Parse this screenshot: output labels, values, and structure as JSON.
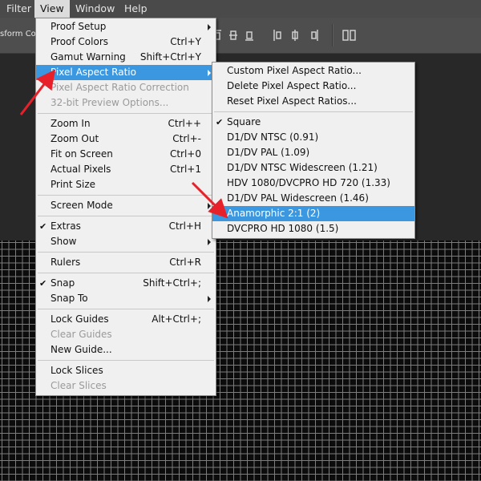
{
  "menubar": {
    "items": [
      {
        "label": "Filter"
      },
      {
        "label": "View"
      },
      {
        "label": "Window"
      },
      {
        "label": "Help"
      }
    ]
  },
  "optionsbar": {
    "transform_label": "sform Con"
  },
  "view_menu": {
    "items": [
      {
        "label": "Proof Setup",
        "shortcut": "",
        "submenu": true
      },
      {
        "label": "Proof Colors",
        "shortcut": "Ctrl+Y"
      },
      {
        "label": "Gamut Warning",
        "shortcut": "Shift+Ctrl+Y"
      },
      {
        "label": "Pixel Aspect Ratio",
        "shortcut": "",
        "submenu": true,
        "highlighted": true
      },
      {
        "label": "Pixel Aspect Ratio Correction",
        "shortcut": "",
        "disabled": true
      },
      {
        "label": "32-bit Preview Options...",
        "shortcut": "",
        "disabled": true
      },
      {
        "label": "Zoom In",
        "shortcut": "Ctrl++"
      },
      {
        "label": "Zoom Out",
        "shortcut": "Ctrl+-"
      },
      {
        "label": "Fit on Screen",
        "shortcut": "Ctrl+0"
      },
      {
        "label": "Actual Pixels",
        "shortcut": "Ctrl+1"
      },
      {
        "label": "Print Size",
        "shortcut": ""
      },
      {
        "label": "Screen Mode",
        "shortcut": "",
        "submenu": true
      },
      {
        "label": "Extras",
        "shortcut": "Ctrl+H",
        "checked": true
      },
      {
        "label": "Show",
        "shortcut": "",
        "submenu": true
      },
      {
        "label": "Rulers",
        "shortcut": "Ctrl+R"
      },
      {
        "label": "Snap",
        "shortcut": "Shift+Ctrl+;",
        "checked": true
      },
      {
        "label": "Snap To",
        "shortcut": "",
        "submenu": true
      },
      {
        "label": "Lock Guides",
        "shortcut": "Alt+Ctrl+;"
      },
      {
        "label": "Clear Guides",
        "shortcut": "",
        "disabled": true
      },
      {
        "label": "New Guide...",
        "shortcut": ""
      },
      {
        "label": "Lock Slices",
        "shortcut": ""
      },
      {
        "label": "Clear Slices",
        "shortcut": "",
        "disabled": true
      }
    ]
  },
  "par_submenu": {
    "items": [
      {
        "label": "Custom Pixel Aspect Ratio..."
      },
      {
        "label": "Delete Pixel Aspect Ratio..."
      },
      {
        "label": "Reset Pixel Aspect Ratios..."
      },
      {
        "label": "Square",
        "checked": true
      },
      {
        "label": "D1/DV NTSC (0.91)"
      },
      {
        "label": "D1/DV PAL (1.09)"
      },
      {
        "label": "D1/DV NTSC Widescreen (1.21)"
      },
      {
        "label": "HDV 1080/DVCPRO HD 720 (1.33)"
      },
      {
        "label": "D1/DV PAL Widescreen (1.46)"
      },
      {
        "label": "Anamorphic 2:1 (2)",
        "highlighted": true
      },
      {
        "label": "DVCPRO HD 1080 (1.5)"
      }
    ]
  },
  "icons": {
    "checkmark": "✔",
    "annotation_color": "#e8202a",
    "highlight_color": "#3b98e0"
  }
}
